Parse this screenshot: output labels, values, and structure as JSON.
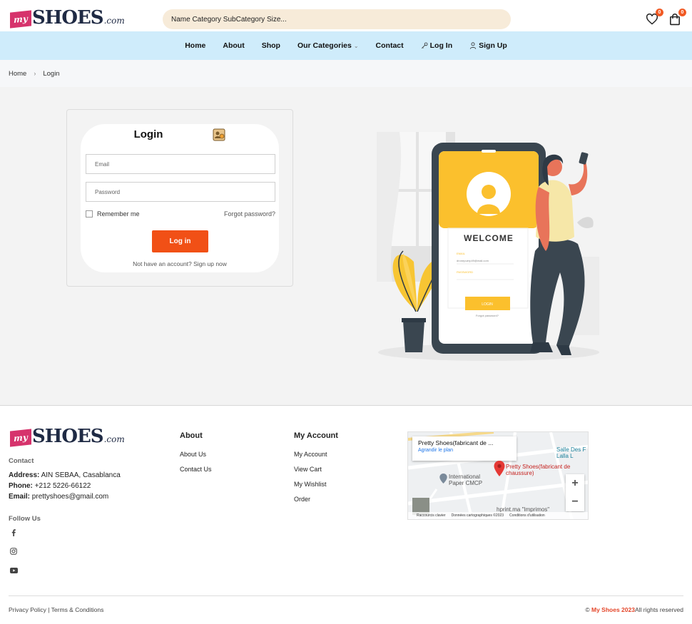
{
  "header": {
    "logo": {
      "badge": "my",
      "name": "SHOES",
      "suffix": ".com"
    },
    "search_placeholder": "Name Category SubCategory Size...",
    "wishlist_count": "0",
    "cart_count": "0",
    "accent_color": "#f15a24"
  },
  "nav": {
    "items": [
      {
        "label": "Home"
      },
      {
        "label": "About"
      },
      {
        "label": "Shop"
      },
      {
        "label": "Our Categories"
      },
      {
        "label": "Contact"
      },
      {
        "label": "Log In"
      },
      {
        "label": "Sign Up"
      }
    ]
  },
  "breadcrumb": {
    "home": "Home",
    "current": "Login"
  },
  "login": {
    "title": "Login",
    "email_placeholder": "Email",
    "password_placeholder": "Password",
    "remember": "Remember me",
    "forgot": "Forgot password?",
    "submit": "Log in",
    "signup": "Not have an account? Sign up now",
    "button_color": "#f15016"
  },
  "illustration": {
    "welcome": "WELCOME",
    "email_label": "EMAIL",
    "email_value": "dronepuerp49@mail.com",
    "password_label": "PASSWORD",
    "button": "LOGIN",
    "forgot": "Forgot password?"
  },
  "footer": {
    "contact_heading": "Contact",
    "address_label": "Address:",
    "address": "AIN SEBAA, Casablanca",
    "phone_label": "Phone:",
    "phone": "+212 5226-66122",
    "email_label": "Email:",
    "email": "prettyshoes@gmail.com",
    "follow": "Follow Us",
    "about_heading": "About",
    "about_links": [
      "About Us",
      "Contact Us"
    ],
    "account_heading": "My Account",
    "account_links": [
      "My Account",
      "View Cart",
      "My Wishlist",
      "Order"
    ],
    "map": {
      "popup_title": "Pretty Shoes(fabricant de ...",
      "popup_link": "Agrandir le plan",
      "place1": "Pretty Shoes(fabricant de chaussure)",
      "place2": "International Paper CMCP",
      "place3": "Salle Des F Lalla L",
      "place4": "hprint.ma \"Imprimos\"",
      "attr1": "Raccourcis clavier",
      "attr2": "Données cartographiques ©2023",
      "attr3": "Conditions d'utilisation"
    },
    "policy": "Privacy Policy | Terms & Conditions",
    "copyright_prefix": "©",
    "copyright_brand": "My Shoes 2023",
    "copyright_suffix": "All rights reserved"
  }
}
